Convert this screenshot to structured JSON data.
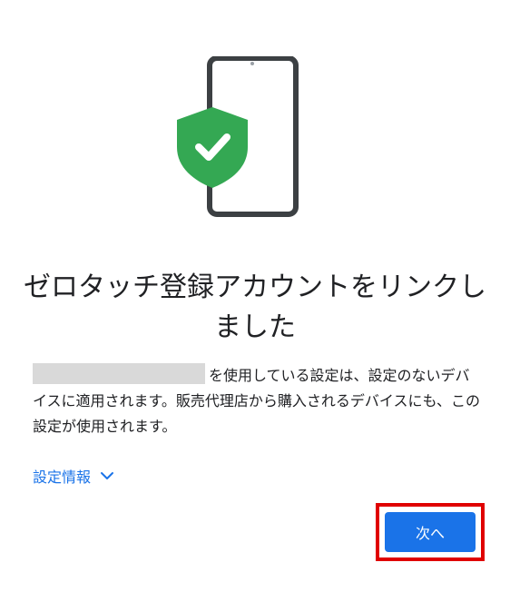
{
  "dialog": {
    "title": "ゼロタッチ登録アカウントをリンクしました",
    "description": "を使用している設定は、設定のないデバイスに適用されます。販売代理店から購入されるデバイスにも、この設定が使用されます。",
    "info_link": "設定情報",
    "next_button": "次へ"
  },
  "icons": {
    "illustration": "phone-with-shield-check-icon",
    "chevron": "chevron-down-icon"
  },
  "colors": {
    "accent": "#1a73e8",
    "shield": "#34a853",
    "highlight": "#e00000",
    "redacted": "#d9d9d9"
  }
}
